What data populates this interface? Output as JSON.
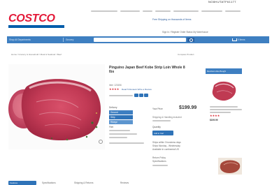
{
  "top_right_id": "NO8HUTATF61177",
  "brand": {
    "logo_text": "COSTCO"
  },
  "top_links": [
    "Warehouse Locations",
    "Special Services",
    "Locator",
    "Pharmacy",
    "Auto and Optical",
    "Costco Travel"
  ],
  "promo_text": "Free Shipping on thousands of Items",
  "account_links": "Sign In / Register   Order Status   My Warehouse",
  "nav": {
    "categories_label": "Shop All Departments",
    "departments_label": "Grocery",
    "search_placeholder": "Search Costco",
    "cart_label": "0 Items"
  },
  "breadcrumb": "Home / Grocery & Household / Meat & Seafood / Beef",
  "compare_text": "Compare Product",
  "product": {
    "title": "Pinguino Japan Beef Kobe Strip Loin Whole 8 lbs",
    "item_number": "Item 123456",
    "stars": "★★★★",
    "reviews_text": "Read 5 Reviews  Write a Review",
    "features_label": "Features",
    "delivery_text": "Delivery",
    "your_price_label": "Your Price",
    "price": "$199.99",
    "shipping_note": "Shipping & Handling included",
    "qty_label": "Quantity",
    "add_to_cart_label": "Add to Cart",
    "option_rows": [
      "Ground",
      "Strip",
      "Ribeye",
      "Filet"
    ],
    "detail_lines": [
      "Product Details",
      "Nutrition"
    ],
    "info_lines": [
      "Ships within 3 business days",
      "Ships Monday - Wednesday",
      "Available in continental US"
    ],
    "warranty_lines": [
      "Return Policy",
      "Specifications"
    ]
  },
  "sidebar": {
    "header": "Members Also Bought",
    "card_stars": "★★★★",
    "card_price": "$199.99"
  },
  "tabs": [
    "Features",
    "Specifications",
    "Shipping & Returns",
    "Reviews"
  ],
  "colors": {
    "brand_red": "#e31837",
    "brand_blue": "#005daa",
    "nav_blue": "#3e7fc1",
    "button_blue": "#2f73b8",
    "star_red": "#d9232e"
  },
  "icons": {
    "search": "search-icon",
    "cart": "cart-icon",
    "zoom": "zoom-icon"
  }
}
